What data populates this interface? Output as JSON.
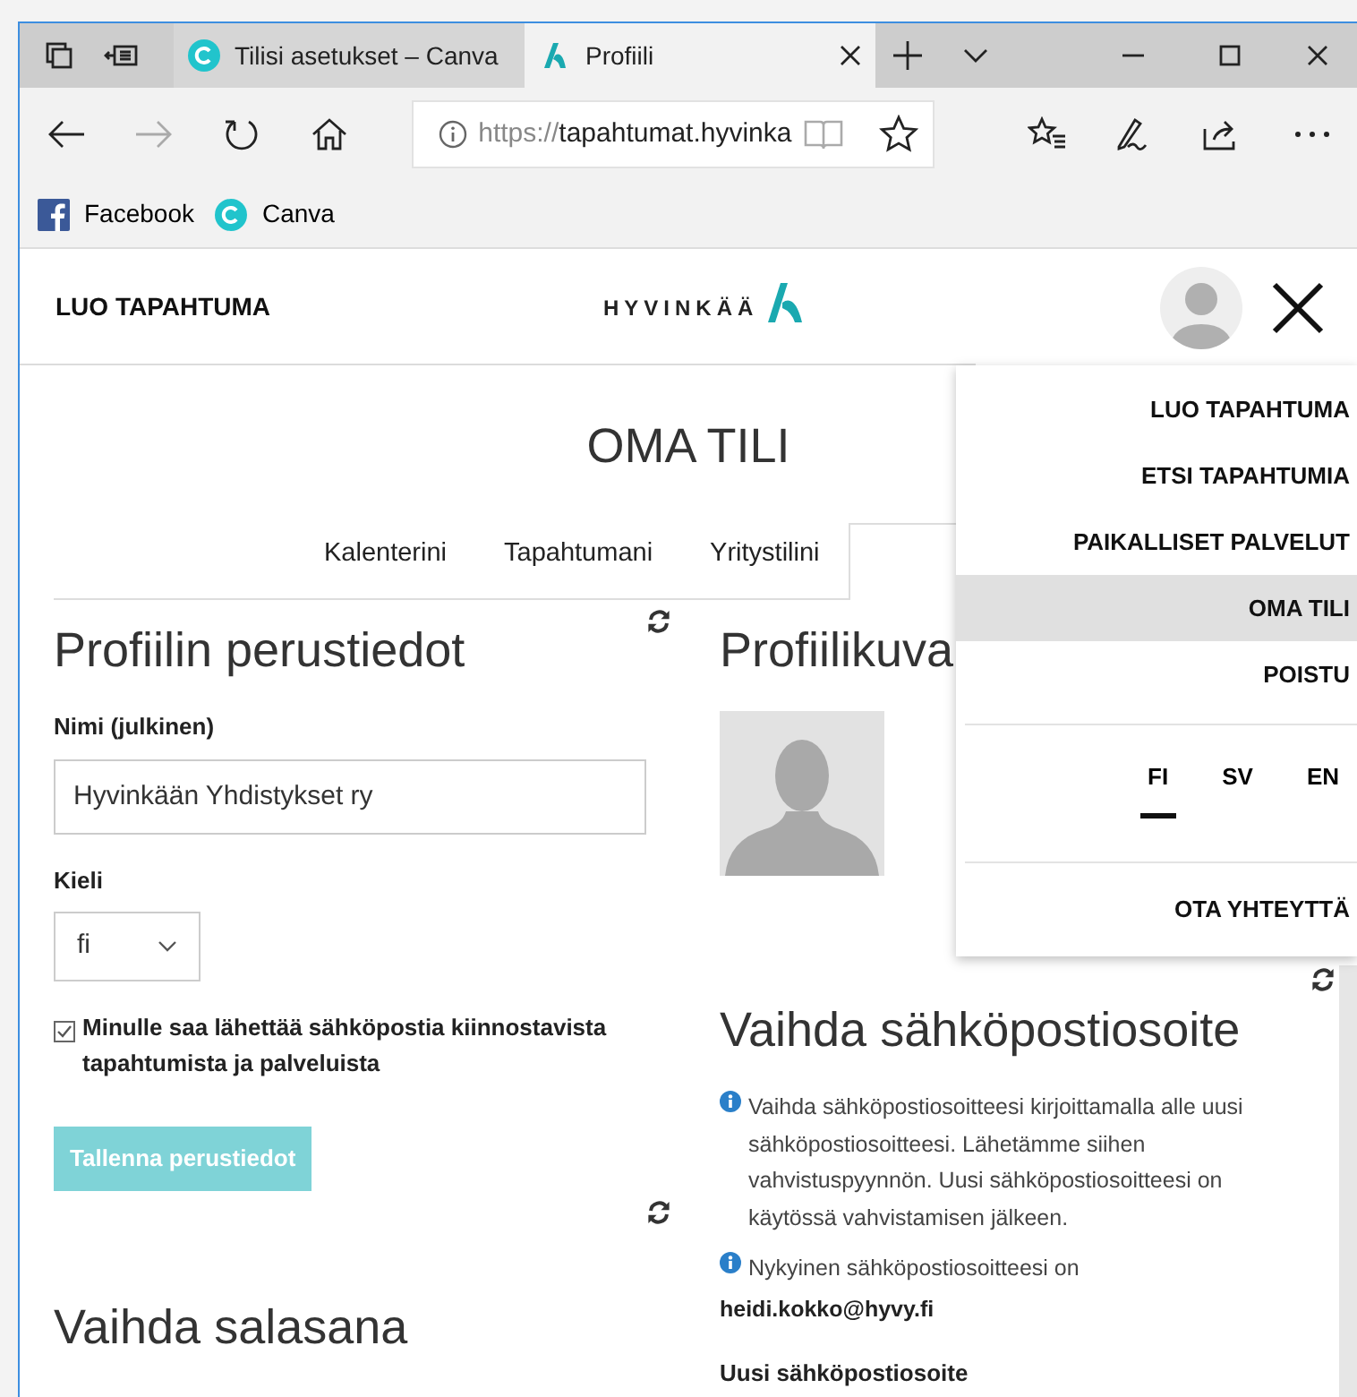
{
  "browser": {
    "tabs": [
      {
        "kind": "canva",
        "title": "Tilisi asetukset – Canva",
        "selected": false
      },
      {
        "kind": "site",
        "title": "Profiili",
        "selected": true
      }
    ],
    "address": {
      "scheme": "https://",
      "host": "tapahtumat.hyvinka"
    },
    "favorites": [
      {
        "kind": "facebook",
        "label": "Facebook"
      },
      {
        "kind": "canva",
        "label": "Canva"
      }
    ]
  },
  "header": {
    "create_link": "LUO TAPAHTUMA",
    "logo": "HYVINKÄÄ"
  },
  "title": "OMA TILI",
  "tabs": [
    {
      "label": "Kalenterini",
      "selected": false
    },
    {
      "label": "Tapahtumani",
      "selected": false
    },
    {
      "label": "Yritystilini",
      "selected": false
    },
    {
      "selected": true
    }
  ],
  "profile": {
    "heading": "Profiilin perustiedot",
    "name_label": "Nimi (julkinen)",
    "name_value": "Hyvinkään Yhdistykset ry",
    "language_label": "Kieli",
    "language_value": "fi",
    "email_consent": {
      "label": "Minulle saa lähettää sähköpostia kiinnostavista tapahtumista ja palveluista",
      "checked": true
    },
    "save_button": {
      "label": "Tallenna perustiedot",
      "disabled": true
    }
  },
  "password": {
    "heading": "Vaihda salasana"
  },
  "picture": {
    "heading": "Profiilikuva"
  },
  "email": {
    "heading": "Vaihda sähköpostiosoite",
    "info": "Vaihda sähköpostiosoitteesi kirjoittamalla alle uusi sähköpostiosoitteesi. Lähetämme siihen vahvistuspyynnön. Uusi sähköpostiosoitteesi on käytössä vahvistamisen jälkeen.",
    "current_label": "Nykyinen sähköpostiosoitteesi on",
    "current_value": "heidi.kokko@hyvy.fi",
    "new_label": "Uusi sähköpostiosoite"
  },
  "menu": {
    "items": [
      {
        "label": "LUO TAPAHTUMA",
        "selected": false
      },
      {
        "label": "ETSI TAPAHTUMIA",
        "selected": false
      },
      {
        "label": "PAIKALLISET PALVELUT",
        "selected": false
      },
      {
        "label": "OMA TILI",
        "selected": true
      },
      {
        "label": "POISTU",
        "selected": false
      }
    ],
    "languages": [
      {
        "label": "FI",
        "selected": true
      },
      {
        "label": "SV",
        "selected": false
      },
      {
        "label": "EN",
        "selected": false
      }
    ],
    "contact": "OTA YHTEYTTÄ"
  }
}
